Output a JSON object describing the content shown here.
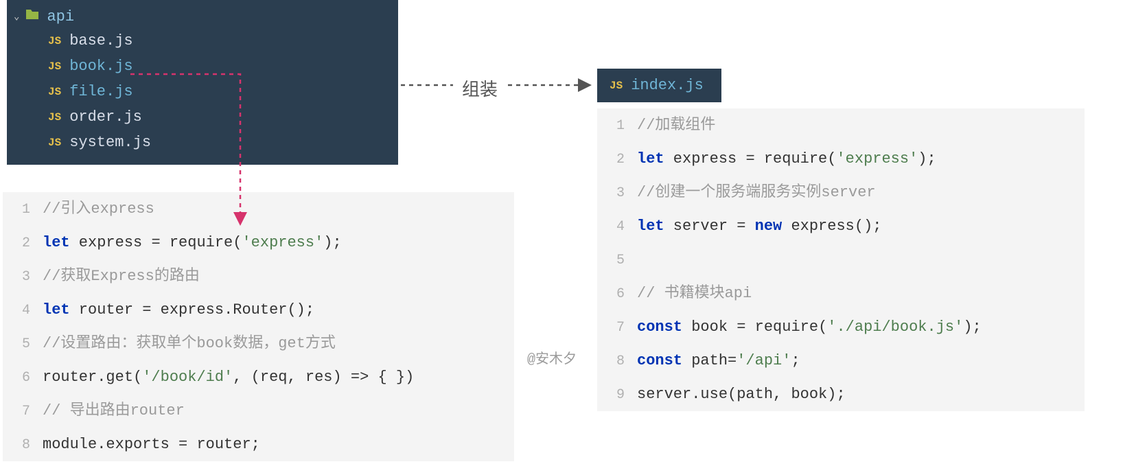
{
  "tree": {
    "folder": "api",
    "files": [
      {
        "name": "base.js",
        "color": "white"
      },
      {
        "name": "book.js",
        "color": "blue"
      },
      {
        "name": "file.js",
        "color": "blue"
      },
      {
        "name": "order.js",
        "color": "white"
      },
      {
        "name": "system.js",
        "color": "white"
      }
    ]
  },
  "tab": {
    "label": "index.js"
  },
  "annotation": {
    "label": "组装",
    "author": "@安木夕"
  },
  "left_code": [
    {
      "n": "1",
      "tokens": [
        {
          "t": "//引入express",
          "c": "comment"
        }
      ]
    },
    {
      "n": "2",
      "tokens": [
        {
          "t": "let",
          "c": "keyword"
        },
        {
          "t": " express ",
          "c": "ident"
        },
        {
          "t": "=",
          "c": "punct"
        },
        {
          "t": " require",
          "c": "ident"
        },
        {
          "t": "(",
          "c": "punct"
        },
        {
          "t": "'express'",
          "c": "string"
        },
        {
          "t": ");",
          "c": "punct"
        }
      ]
    },
    {
      "n": "3",
      "tokens": [
        {
          "t": "//获取Express的路由",
          "c": "comment"
        }
      ]
    },
    {
      "n": "4",
      "tokens": [
        {
          "t": "let",
          "c": "keyword"
        },
        {
          "t": " router ",
          "c": "ident"
        },
        {
          "t": "=",
          "c": "punct"
        },
        {
          "t": " express",
          "c": "ident"
        },
        {
          "t": ".",
          "c": "punct"
        },
        {
          "t": "Router",
          "c": "ident"
        },
        {
          "t": "();",
          "c": "punct"
        }
      ]
    },
    {
      "n": "5",
      "tokens": [
        {
          "t": "//设置路由：获取单个book数据，get方式",
          "c": "comment"
        }
      ]
    },
    {
      "n": "6",
      "tokens": [
        {
          "t": "router",
          "c": "ident"
        },
        {
          "t": ".",
          "c": "punct"
        },
        {
          "t": "get",
          "c": "ident"
        },
        {
          "t": "(",
          "c": "punct"
        },
        {
          "t": "'/book/id'",
          "c": "string"
        },
        {
          "t": ", (",
          "c": "punct"
        },
        {
          "t": "req",
          "c": "ident"
        },
        {
          "t": ", ",
          "c": "punct"
        },
        {
          "t": "res",
          "c": "ident"
        },
        {
          "t": ") ",
          "c": "punct"
        },
        {
          "t": "=>",
          "c": "punct"
        },
        {
          "t": " { })",
          "c": "punct"
        }
      ]
    },
    {
      "n": "7",
      "tokens": [
        {
          "t": "// 导出路由router",
          "c": "comment"
        }
      ]
    },
    {
      "n": "8",
      "tokens": [
        {
          "t": "module",
          "c": "ident"
        },
        {
          "t": ".",
          "c": "punct"
        },
        {
          "t": "exports ",
          "c": "ident"
        },
        {
          "t": "=",
          "c": "punct"
        },
        {
          "t": " router",
          "c": "ident"
        },
        {
          "t": ";",
          "c": "punct"
        }
      ]
    }
  ],
  "right_code": [
    {
      "n": "1",
      "tokens": [
        {
          "t": "//加载组件",
          "c": "comment"
        }
      ]
    },
    {
      "n": "2",
      "tokens": [
        {
          "t": "let",
          "c": "keyword"
        },
        {
          "t": " express ",
          "c": "ident"
        },
        {
          "t": "=",
          "c": "punct"
        },
        {
          "t": " require",
          "c": "ident"
        },
        {
          "t": "(",
          "c": "punct"
        },
        {
          "t": "'express'",
          "c": "string"
        },
        {
          "t": ");",
          "c": "punct"
        }
      ]
    },
    {
      "n": "3",
      "tokens": [
        {
          "t": "//创建一个服务端服务实例server",
          "c": "comment"
        }
      ]
    },
    {
      "n": "4",
      "tokens": [
        {
          "t": "let",
          "c": "keyword"
        },
        {
          "t": " server ",
          "c": "ident"
        },
        {
          "t": "=",
          "c": "punct"
        },
        {
          "t": " ",
          "c": "ident"
        },
        {
          "t": "new",
          "c": "keyword"
        },
        {
          "t": " express",
          "c": "ident"
        },
        {
          "t": "();",
          "c": "punct"
        }
      ]
    },
    {
      "n": "5",
      "tokens": []
    },
    {
      "n": "6",
      "tokens": [
        {
          "t": "// 书籍模块api",
          "c": "comment"
        }
      ]
    },
    {
      "n": "7",
      "tokens": [
        {
          "t": "const",
          "c": "keyword"
        },
        {
          "t": " book ",
          "c": "ident"
        },
        {
          "t": "=",
          "c": "punct"
        },
        {
          "t": " require",
          "c": "ident"
        },
        {
          "t": "(",
          "c": "punct"
        },
        {
          "t": "'./api/book.js'",
          "c": "string"
        },
        {
          "t": ");",
          "c": "punct"
        }
      ]
    },
    {
      "n": "8",
      "tokens": [
        {
          "t": "const",
          "c": "keyword"
        },
        {
          "t": " path",
          "c": "ident"
        },
        {
          "t": "=",
          "c": "punct"
        },
        {
          "t": "'/api'",
          "c": "string"
        },
        {
          "t": ";",
          "c": "punct"
        }
      ]
    },
    {
      "n": "9",
      "tokens": [
        {
          "t": "server",
          "c": "ident"
        },
        {
          "t": ".",
          "c": "punct"
        },
        {
          "t": "use",
          "c": "ident"
        },
        {
          "t": "(",
          "c": "punct"
        },
        {
          "t": "path",
          "c": "ident"
        },
        {
          "t": ", ",
          "c": "punct"
        },
        {
          "t": "book",
          "c": "ident"
        },
        {
          "t": ");",
          "c": "punct"
        }
      ]
    }
  ]
}
